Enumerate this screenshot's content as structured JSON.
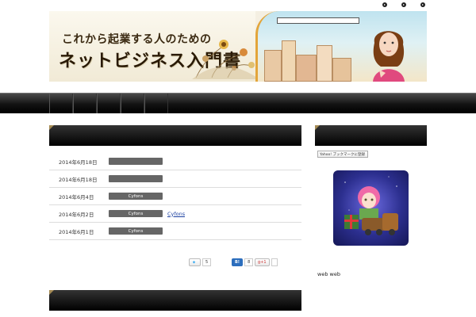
{
  "top_links": [
    "",
    "",
    ""
  ],
  "banner": {
    "title_small": "これから起業する人のための",
    "title_big": "ネットビジネス入門書",
    "caption": ""
  },
  "tagline": "",
  "nav": {
    "items": [
      "",
      "",
      "",
      "",
      ""
    ]
  },
  "news": {
    "heading": "",
    "items": [
      {
        "date": "2014年6月18日",
        "category": "",
        "title": ""
      },
      {
        "date": "2014年6月18日",
        "category": "",
        "title": ""
      },
      {
        "date": "2014年6月4日",
        "category": "Cyfons",
        "title": ""
      },
      {
        "date": "2014年6月2日",
        "category": "Cyfons",
        "title": "Cyfons"
      },
      {
        "date": "2014年6月1日",
        "category": "Cyfons",
        "title": ""
      }
    ]
  },
  "social": {
    "tweet_label": "",
    "tweet_count": "5",
    "hatena_label": "B!",
    "hatena_count": "8",
    "gplus_label": "g+1",
    "gplus_count": ""
  },
  "section2": {
    "heading": ""
  },
  "sidebar": {
    "heading": "",
    "yahoo_label": "Yahoo! ブックマークに登録",
    "lines": [
      {
        "text": "",
        "link": false
      },
      {
        "text": "",
        "link": false
      },
      {
        "text": "web web",
        "link": false
      },
      {
        "text": "",
        "link": false
      },
      {
        "text": "",
        "link": true
      },
      {
        "text": "",
        "link": false
      },
      {
        "text": "",
        "link": false
      }
    ]
  },
  "colors": {
    "accent_gold": "#a58b55",
    "link": "#1a3fa0",
    "nav_bg": "#000000",
    "banner_orange": "#e3a53a"
  }
}
